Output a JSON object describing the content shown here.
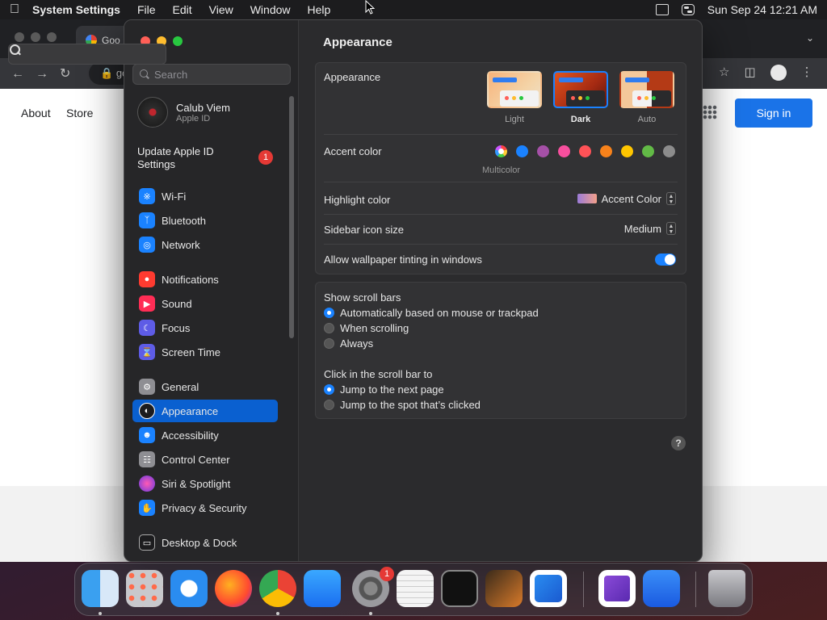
{
  "menubar": {
    "app": "System Settings",
    "items": [
      "File",
      "Edit",
      "View",
      "Window",
      "Help"
    ],
    "clock": "Sun Sep 24  12:21 AM"
  },
  "browser": {
    "tab_title": "Goo",
    "address": "go",
    "links": [
      "About",
      "Store"
    ],
    "signin": "Sign in"
  },
  "sidebar": {
    "search_placeholder": "Search",
    "profile_name": "Calub Viem",
    "profile_sub": "Apple ID",
    "update_label": "Update Apple ID Settings",
    "update_badge": "1",
    "items": [
      {
        "label": "Wi-Fi",
        "icon": "wifi-icon",
        "color": "#1a82ff"
      },
      {
        "label": "Bluetooth",
        "icon": "bluetooth-icon",
        "color": "#1a82ff"
      },
      {
        "label": "Network",
        "icon": "globe-icon",
        "color": "#1a82ff"
      },
      {
        "label": "Notifications",
        "icon": "bell-icon",
        "color": "#ff3b30"
      },
      {
        "label": "Sound",
        "icon": "speaker-icon",
        "color": "#ff2d55"
      },
      {
        "label": "Focus",
        "icon": "moon-icon",
        "color": "#5e5ce6"
      },
      {
        "label": "Screen Time",
        "icon": "hourglass-icon",
        "color": "#5e5ce6"
      },
      {
        "label": "General",
        "icon": "gear-icon",
        "color": "#8e8e93"
      },
      {
        "label": "Appearance",
        "icon": "appearance-icon",
        "color": "#1c1c1e"
      },
      {
        "label": "Accessibility",
        "icon": "accessibility-icon",
        "color": "#1a82ff"
      },
      {
        "label": "Control Center",
        "icon": "control-center-icon",
        "color": "#8e8e93"
      },
      {
        "label": "Siri & Spotlight",
        "icon": "siri-icon",
        "color": "#a040d0"
      },
      {
        "label": "Privacy & Security",
        "icon": "hand-icon",
        "color": "#1a82ff"
      },
      {
        "label": "Desktop & Dock",
        "icon": "dock-icon",
        "color": "#1c1c1e"
      }
    ]
  },
  "content": {
    "title": "Appearance",
    "appearance_label": "Appearance",
    "themes": [
      "Light",
      "Dark",
      "Auto"
    ],
    "accent_label": "Accent color",
    "accent_sub": "Multicolor",
    "accent_colors": [
      "#1a82ff",
      "#a550a7",
      "#f74f9e",
      "#ff5257",
      "#f7821b",
      "#ffc600",
      "#62ba46",
      "#8c8c8c"
    ],
    "highlight_label": "Highlight color",
    "highlight_value": "Accent Color",
    "sidebar_icon_label": "Sidebar icon size",
    "sidebar_icon_value": "Medium",
    "tinting_label": "Allow wallpaper tinting in windows",
    "scroll_label": "Show scroll bars",
    "scroll_options": [
      "Automatically based on mouse or trackpad",
      "When scrolling",
      "Always"
    ],
    "click_label": "Click in the scroll bar to",
    "click_options": [
      "Jump to the next page",
      "Jump to the spot that’s clicked"
    ],
    "help": "?"
  },
  "dock": {
    "badge": "1"
  }
}
